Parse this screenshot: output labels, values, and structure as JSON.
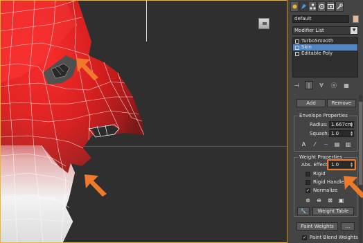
{
  "command_panel": {
    "tab_icons": [
      "create-icon",
      "modify-icon",
      "hierarchy-icon",
      "motion-icon",
      "display-icon",
      "utilities-icon"
    ],
    "object_name": "default",
    "object_color": "#e4b896",
    "modifier_list": {
      "label": "Modifier List"
    },
    "modifier_stack": [
      {
        "label": "TurboSmooth",
        "selected": false
      },
      {
        "label": "Skin",
        "selected": true
      },
      {
        "label": "Editable Poly",
        "selected": false
      }
    ]
  },
  "skin": {
    "add_label": "Add",
    "remove_label": "Remove",
    "envelope": {
      "title": "Envelope Properties",
      "radius_label": "Radius:",
      "radius_value": "1.667cm",
      "squash_label": "Squash:",
      "squash_value": "1.0"
    },
    "weight": {
      "title": "Weight Properties",
      "abs_effect_label": "Abs. Effect:",
      "abs_effect_value": "1.0",
      "rigid_label": "Rigid",
      "rigid_checked": false,
      "rigid_handles_label": "Rigid Handles",
      "rigid_handles_checked": false,
      "normalize_label": "Normalize",
      "normalize_checked": true,
      "weight_table_label": "Weight Table",
      "paint_weights_label": "Paint Weights",
      "paint_more_label": "...",
      "paint_blend_label": "Paint Blend Weights",
      "paint_blend_checked": true
    }
  },
  "colors": {
    "highlight": "#f07a2b",
    "selection": "#4f86c6",
    "viewport_border": "#f0b429"
  }
}
